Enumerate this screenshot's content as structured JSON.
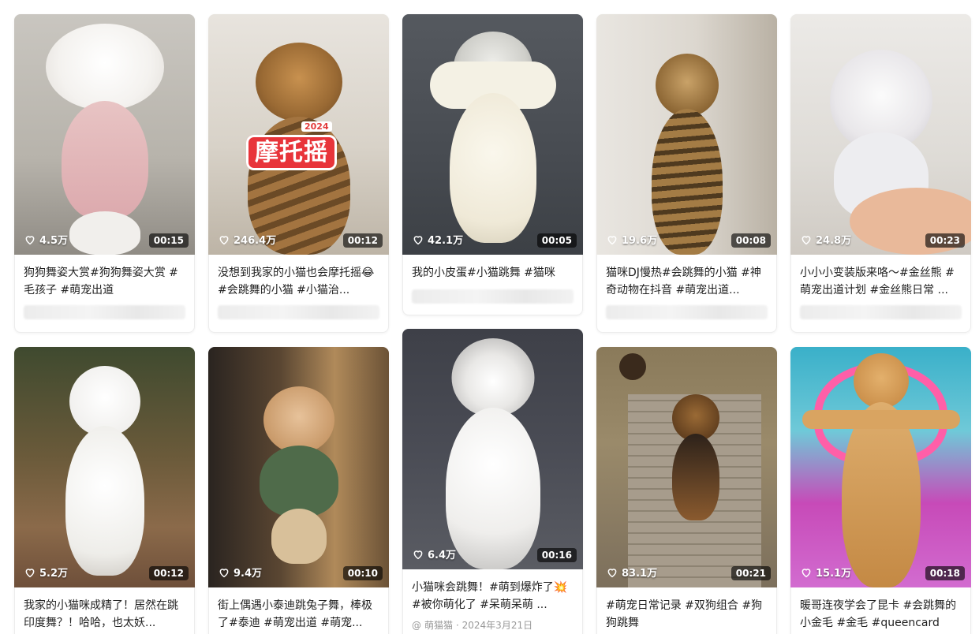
{
  "icons": {
    "like": "heart-outline-icon",
    "author": "at-icon"
  },
  "cards": [
    {
      "likes": "4.5万",
      "duration": "00:15",
      "caption": "狗狗舞姿大赏#狗狗舞姿大赏 #毛孩子 #萌宠出道"
    },
    {
      "likes": "246.4万",
      "duration": "00:12",
      "caption": "没想到我家的小猫也会摩托摇😂#会跳舞的小猫 #小猫治...",
      "sticker_year": "2024",
      "sticker_text": "摩托摇"
    },
    {
      "likes": "42.1万",
      "duration": "00:05",
      "caption": "我的小皮蛋#小猫跳舞 #猫咪"
    },
    {
      "likes": "19.6万",
      "duration": "00:08",
      "caption": "猫咪DJ慢热#会跳舞的小猫 #神奇动物在抖音 #萌宠出道..."
    },
    {
      "likes": "24.8万",
      "duration": "00:23",
      "caption": "小小小变装版来咯～#金丝熊 #萌宠出道计划 #金丝熊日常 ..."
    },
    {
      "likes": "5.2万",
      "duration": "00:12",
      "caption": "我家的小猫咪成精了！居然在跳印度舞？！哈哈，也太妖..."
    },
    {
      "likes": "9.4万",
      "duration": "00:10",
      "caption": "街上偶遇小泰迪跳兔子舞，棒极了#泰迪 #萌宠出道 #萌宠..."
    },
    {
      "likes": "6.4万",
      "duration": "00:16",
      "caption": "小猫咪会跳舞！#萌到爆炸了💥 #被你萌化了 #呆萌呆萌 ...",
      "author": "萌猫猫",
      "date": "· 2024年3月21日"
    },
    {
      "likes": "83.1万",
      "duration": "00:21",
      "caption": "#萌宠日常记录 #双狗组合 #狗狗跳舞"
    },
    {
      "likes": "15.1万",
      "duration": "00:18",
      "caption": "暖哥连夜学会了昆卡 #会跳舞的小金毛 #金毛 #queencard"
    }
  ]
}
